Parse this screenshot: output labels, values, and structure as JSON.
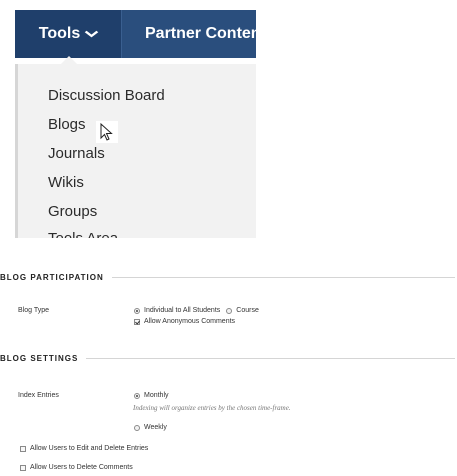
{
  "nav": {
    "tools_label": "Tools",
    "tools_chevron": "⌄",
    "partner_label": "Partner Content"
  },
  "dropdown": {
    "items": [
      "Discussion Board",
      "Blogs",
      "Journals",
      "Wikis",
      "Groups",
      "Tools Area"
    ]
  },
  "blog_participation": {
    "heading": "BLOG PARTICIPATION",
    "blog_type_label": "Blog Type",
    "option_individual": "Individual to All Students",
    "option_course": "Course",
    "anonymous_label": "Allow Anonymous Comments"
  },
  "blog_settings": {
    "heading": "BLOG SETTINGS",
    "index_label": "Index Entries",
    "option_monthly": "Monthly",
    "index_hint": "Indexing will organize entries by the chosen time-frame.",
    "option_weekly": "Weekly",
    "edit_delete_label": "Allow Users to Edit and Delete Entries",
    "delete_comments_label": "Allow Users to Delete Comments"
  },
  "colors": {
    "nav_bg": "#2a4e7d",
    "nav_active_bg": "#1f3f6b",
    "dropdown_bg": "#f2f2f2"
  }
}
